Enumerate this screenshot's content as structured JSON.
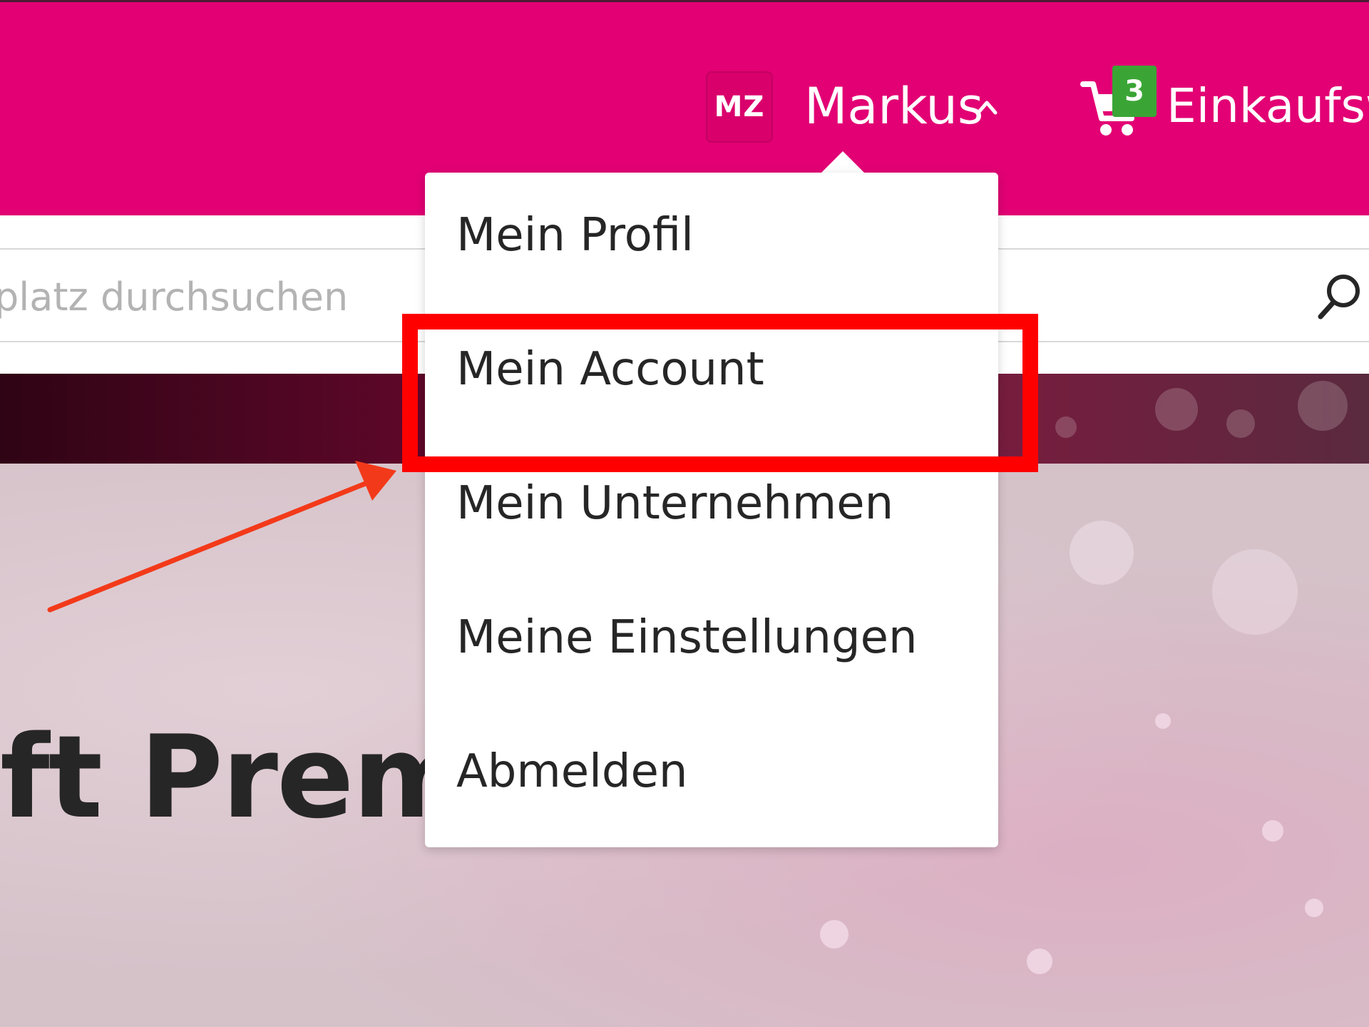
{
  "header": {
    "avatar_initials": "MZ",
    "user_name": "Markus",
    "caret_icon": "chevron-up-icon",
    "cart": {
      "icon": "shopping-cart-icon",
      "badge_count": "3",
      "label": "Einkaufsw"
    }
  },
  "search": {
    "placeholder": "platz durchsuchen",
    "icon": "search-icon"
  },
  "hero": {
    "title_fragment": "ft Premiu"
  },
  "user_menu": {
    "items": [
      {
        "label": "Mein Profil"
      },
      {
        "label": "Mein Account",
        "highlighted": true
      },
      {
        "label": "Mein Unternehmen"
      },
      {
        "label": "Meine Einstellungen"
      },
      {
        "label": "Abmelden"
      }
    ]
  },
  "colors": {
    "brand_magenta": "#e20074",
    "badge_green": "#3aa535",
    "annotation_red": "#ff0000",
    "arrow_red": "#f23a1a"
  }
}
